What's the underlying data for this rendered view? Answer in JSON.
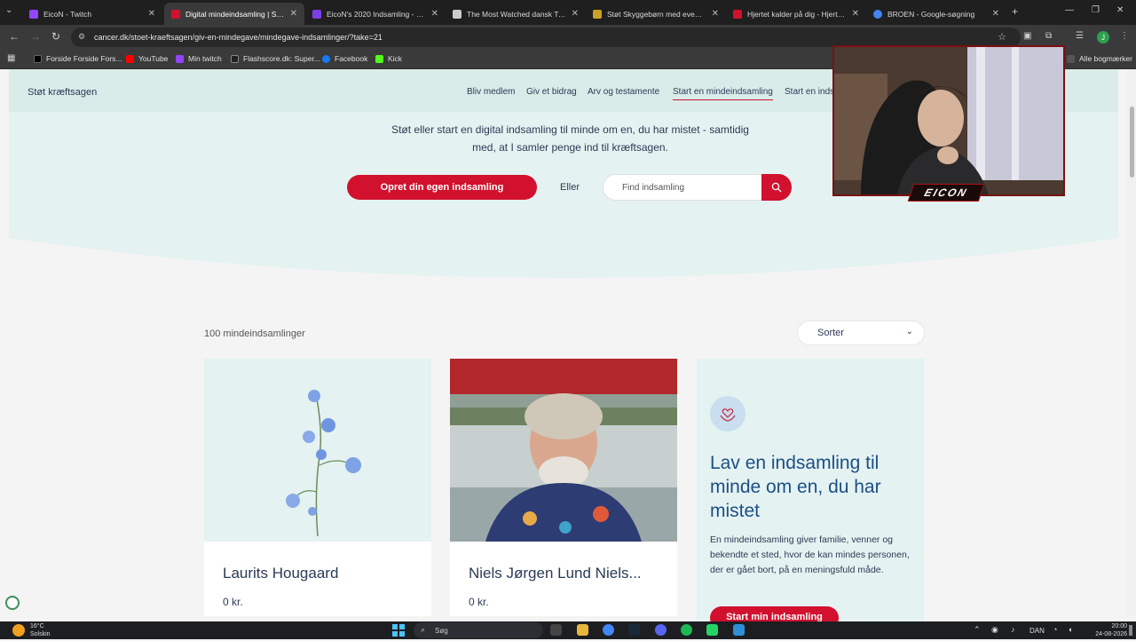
{
  "tabs": [
    {
      "title": "EicoN - Twitch",
      "favicon_color": "#9146ff",
      "active": false
    },
    {
      "title": "Digital mindeindsamling | Start",
      "favicon_color": "#d1112e",
      "active": true
    },
    {
      "title": "EicoN's 2020 Indsamling - Live",
      "favicon_color": "#7b3fe4",
      "active": false
    },
    {
      "title": "The Most Watched dansk Twitc",
      "favicon_color": "#cccccc",
      "active": false
    },
    {
      "title": "Støt Skyggebørn med event | H",
      "favicon_color": "#c9a227",
      "active": false
    },
    {
      "title": "Hjertet kalder på dig - Hjertefo",
      "favicon_color": "#d1112e",
      "active": false
    },
    {
      "title": "BROEN - Google-søgning",
      "favicon_color": "#4285f4",
      "active": false
    }
  ],
  "url": "cancer.dk/stoet-kraeftsagen/giv-en-mindegave/mindegave-indsamlinger/?take=21",
  "bookmarks": [
    {
      "label": "Forside Forside Fors...",
      "color": "#000000"
    },
    {
      "label": "YouTube",
      "color": "#ff0000"
    },
    {
      "label": "Min twitch",
      "color": "#9146ff"
    },
    {
      "label": "Flashscore.dk: Super...",
      "color": "#222222"
    },
    {
      "label": "Facebook",
      "color": "#1877f2"
    },
    {
      "label": "Kick",
      "color": "#53fc18"
    }
  ],
  "all_bookmarks": "Alle bogmærker",
  "site": {
    "brand": "Støt kræftsagen",
    "nav": [
      "Bliv medlem",
      "Giv et bidrag",
      "Arv og testamente",
      "Start en mindeindsamling",
      "Start en inds"
    ],
    "intro_line1": "Støt eller start en digital indsamling til minde om en, du har mistet - samtidig",
    "intro_line2": "med, at I samler penge ind til kræftsagen.",
    "cta": "Opret din egen indsamling",
    "or": "Eller",
    "search_placeholder": "Find indsamling",
    "count_label": "100 mindeindsamlinger",
    "sort_label": "Sorter",
    "cards": [
      {
        "name": "Laurits Hougaard",
        "amount": "0 kr."
      },
      {
        "name": "Niels Jørgen Lund Niels...",
        "amount": "0 kr."
      }
    ],
    "promo": {
      "title": "Lav en indsamling til minde om en, du har mistet",
      "body": "En mindeindsamling giver familie, venner og bekendte et sted, hvor de kan mindes personen, der er gået bort, på en meningsfuld måde.",
      "button": "Start min indsamling"
    }
  },
  "overlay": {
    "streamer_tag": "EICON"
  },
  "taskbar": {
    "weather_temp": "16°C",
    "weather_desc": "Solskin",
    "search_placeholder": "Søg",
    "lang": "DAN",
    "time": "20:00",
    "date": "24-08-2026"
  }
}
